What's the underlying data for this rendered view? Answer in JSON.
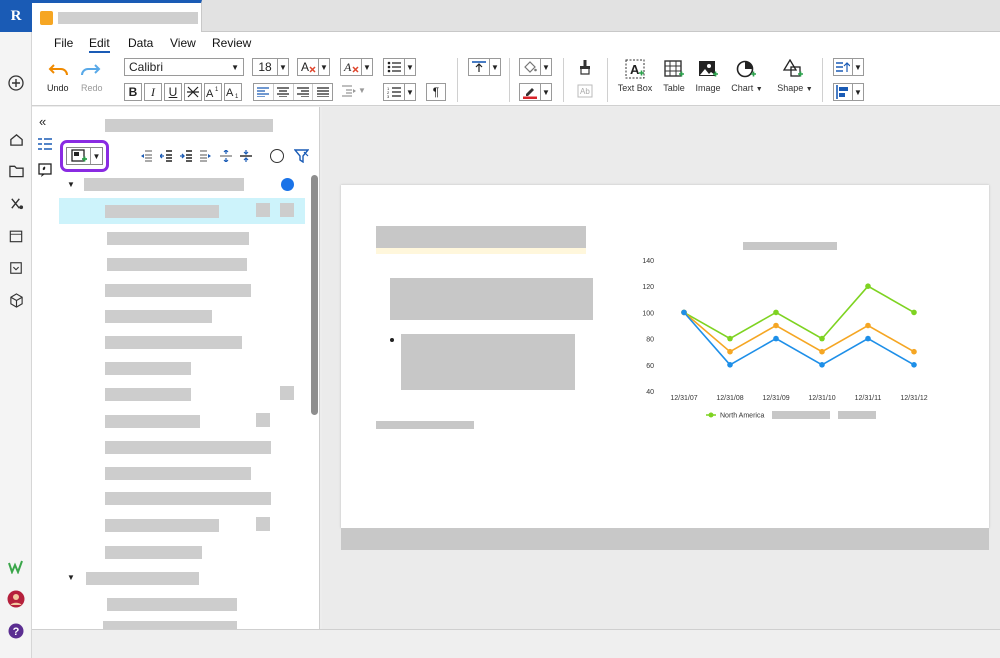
{
  "app": {
    "logo_letter": "R"
  },
  "menu": [
    "File",
    "Edit",
    "Data",
    "View",
    "Review"
  ],
  "toolbar": {
    "undo_label": "Undo",
    "redo_label": "Redo",
    "font_name": "Calibri",
    "font_size": "18",
    "pilcrow": "¶",
    "textbox_label": "Text Box",
    "table_label": "Table",
    "image_label": "Image",
    "chart_label": "Chart",
    "shape_label": "Shape"
  },
  "colors": {
    "accent": "#1a5bb5",
    "highlight_outline": "#8a2be2",
    "series_green": "#7ed321",
    "series_orange": "#f5a623",
    "series_blue": "#1e8fe8",
    "selected_row": "#cdf3fb"
  },
  "chart_data": {
    "type": "line",
    "categories": [
      "12/31/07",
      "12/31/08",
      "12/31/09",
      "12/31/10",
      "12/31/11",
      "12/31/12"
    ],
    "yticks": [
      "140",
      "120",
      "100",
      "80",
      "60",
      "40"
    ],
    "ylim": [
      40,
      140
    ],
    "series": [
      {
        "name": "North America",
        "color": "#7ed321",
        "values": [
          100,
          80,
          100,
          80,
          120,
          100
        ]
      },
      {
        "color": "#f5a623",
        "values": [
          100,
          70,
          90,
          70,
          90,
          70
        ]
      },
      {
        "color": "#1e8fe8",
        "values": [
          100,
          60,
          80,
          60,
          80,
          60
        ]
      }
    ],
    "legend_position": "bottom"
  }
}
